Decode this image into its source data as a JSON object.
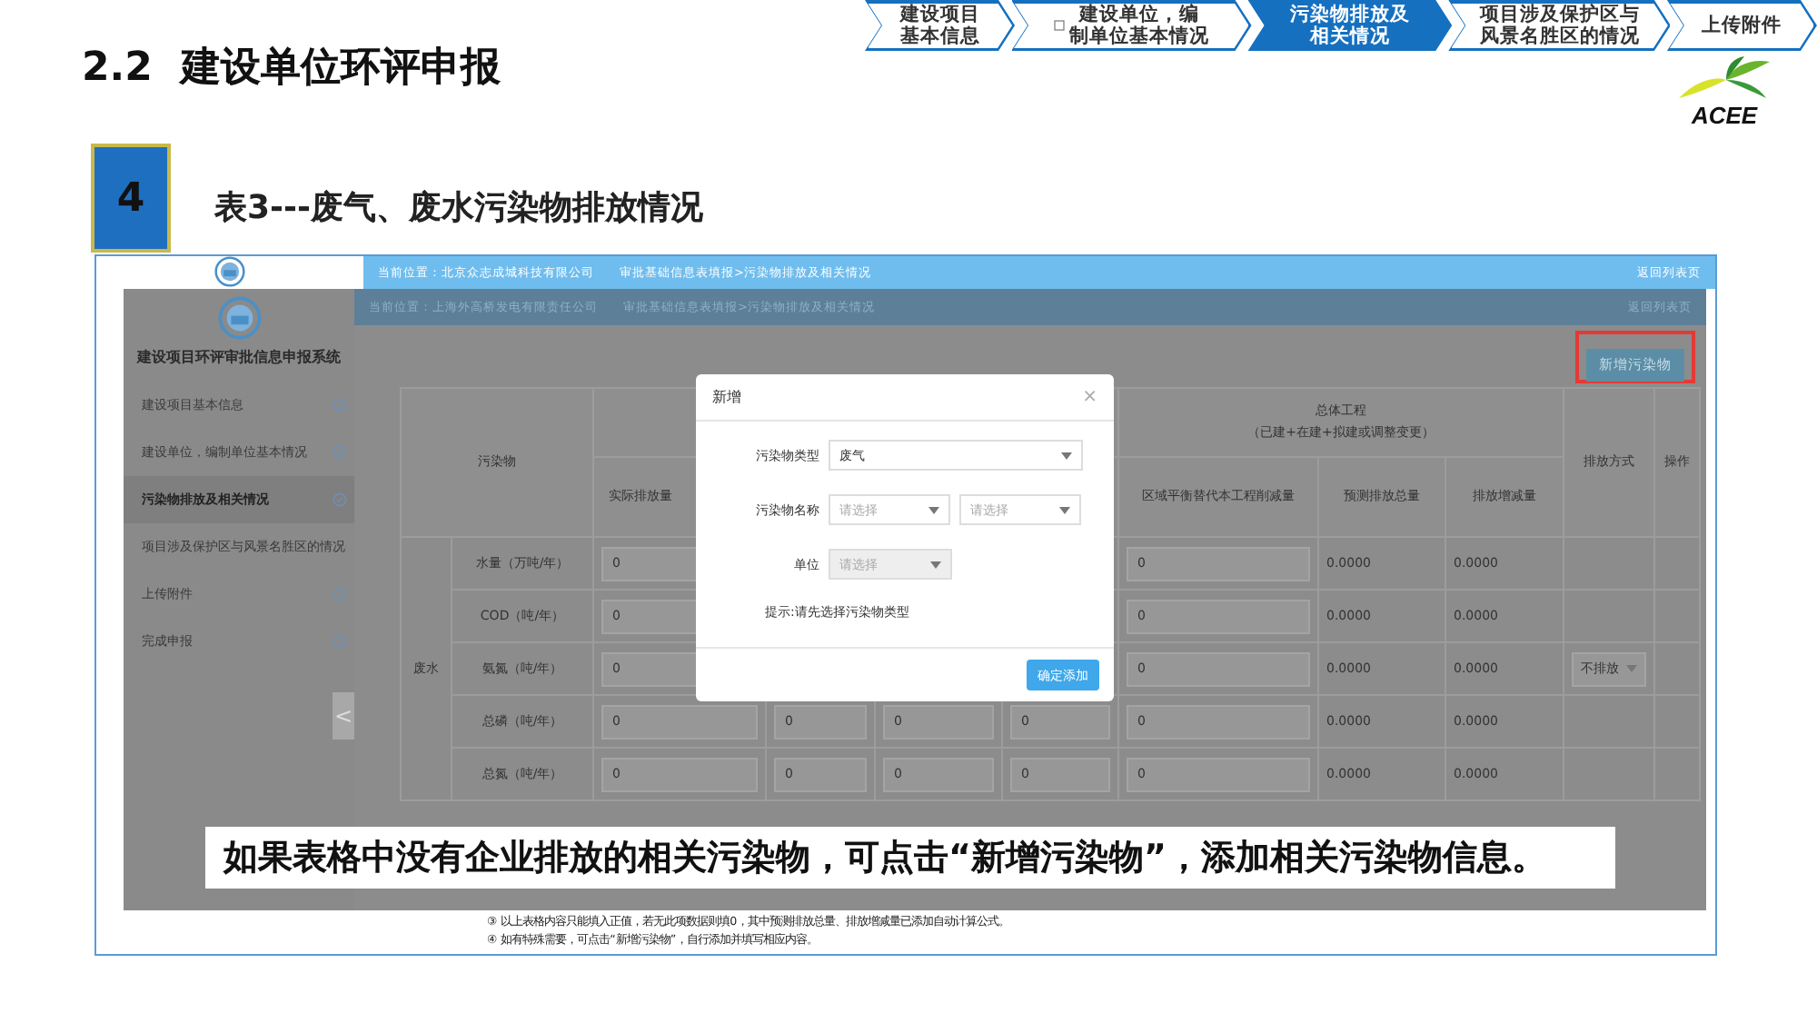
{
  "slide": {
    "title": "2.2  建设单位环评申报",
    "logo_text": "ACEE"
  },
  "steps": [
    {
      "lines": [
        "建设项目",
        "基本信息"
      ],
      "selected": false,
      "has_icon": false
    },
    {
      "lines": [
        "建设单位，编",
        "制单位基本情况"
      ],
      "selected": false,
      "has_icon": true
    },
    {
      "lines": [
        "污染物排放及",
        "相关情况"
      ],
      "selected": true,
      "has_icon": false
    },
    {
      "lines": [
        "项目涉及保护区与",
        "风景名胜区的情况"
      ],
      "selected": false,
      "has_icon": false
    },
    {
      "lines": [
        "上传附件"
      ],
      "selected": false,
      "has_icon": false
    }
  ],
  "section": {
    "number": "4",
    "heading": "表3---废气、废水污染物排放情况"
  },
  "outer_bar": {
    "location": "当前位置：北京众志成城科技有限公司",
    "path": "审批基础信息表填报>污染物排放及相关情况",
    "back": "返回列表页"
  },
  "sidebar": {
    "title": "建设项目环评审批信息申报系统",
    "items": [
      {
        "label": "建设项目基本信息",
        "kind": "done",
        "selected": false
      },
      {
        "label": "建设单位，编制单位基本情况",
        "kind": "done",
        "selected": false
      },
      {
        "label": "污染物排放及相关情况",
        "kind": "done",
        "selected": true
      },
      {
        "label": "项目涉及保护区与风景名胜区的情况",
        "kind": "pending",
        "selected": false
      },
      {
        "label": "上传附件",
        "kind": "pending",
        "selected": false
      },
      {
        "label": "完成申报",
        "kind": "pending",
        "selected": false
      }
    ],
    "collapse": "<"
  },
  "inner_bar": {
    "location": "当前位置：上海外高桥发电有限责任公司",
    "path": "审批基础信息表填报>污染物排放及相关情况",
    "back": "返回列表页"
  },
  "add_button": {
    "label": "新增污染物",
    "highlighted": true
  },
  "table": {
    "pollutant_header": "污染物",
    "overall_header": {
      "title": "总体工程",
      "note": "（已建+在建+拟建或调整变更）"
    },
    "method_header": "排放方式",
    "action_header": "操作",
    "sub_headers": {
      "actual": "实际排放量",
      "regional": "区域平衡替代本工程削减量",
      "predicted": "预测排放总量",
      "change": "排放增减量"
    },
    "category": "废水",
    "rows": [
      {
        "item": "水量（万吨/年）",
        "actual": "0",
        "regional": "0",
        "predicted": "0.0000",
        "change": "0.0000"
      },
      {
        "item": "COD（吨/年）",
        "actual": "0",
        "regional": "0",
        "predicted": "0.0000",
        "change": "0.0000"
      },
      {
        "item": "氨氮（吨/年）",
        "actual": "0",
        "regional": "0",
        "predicted": "0.0000",
        "change": "0.0000",
        "method": "不排放"
      },
      {
        "item": "总磷（吨/年）",
        "actual": "0",
        "middle": [
          "0",
          "0",
          "0"
        ],
        "regional": "0",
        "predicted": "0.0000",
        "change": "0.0000"
      },
      {
        "item": "总氮（吨/年）",
        "actual": "0",
        "middle": [
          "0",
          "0",
          "0"
        ],
        "regional": "0",
        "predicted": "0.0000",
        "change": "0.0000"
      }
    ]
  },
  "dialog": {
    "title": "新增",
    "close": "×",
    "fields": [
      {
        "label": "污染物类型",
        "kind": "select",
        "value": "废气",
        "disabled": false
      },
      {
        "label": "污染物名称",
        "kind": "pair",
        "placeholders": [
          "请选择",
          "请选择"
        ],
        "disabled": false
      },
      {
        "label": "单位",
        "kind": "select",
        "placeholder": "请选择",
        "disabled": true
      }
    ],
    "hint": "提示:请先选择污染物类型",
    "confirm": "确定添加"
  },
  "caption": "如果表格中没有企业排放的相关污染物，可点击“新增污染物”，添加相关污染物信息。",
  "notes": [
    "③ 以上表格内容只能填入正值，若无此项数据则填0，其中预测排放总量、排放增减量已添加自动计算公式。",
    "④ 如有特殊需要，可点击“新增污染物”，自行添加并填写相应内容。"
  ]
}
